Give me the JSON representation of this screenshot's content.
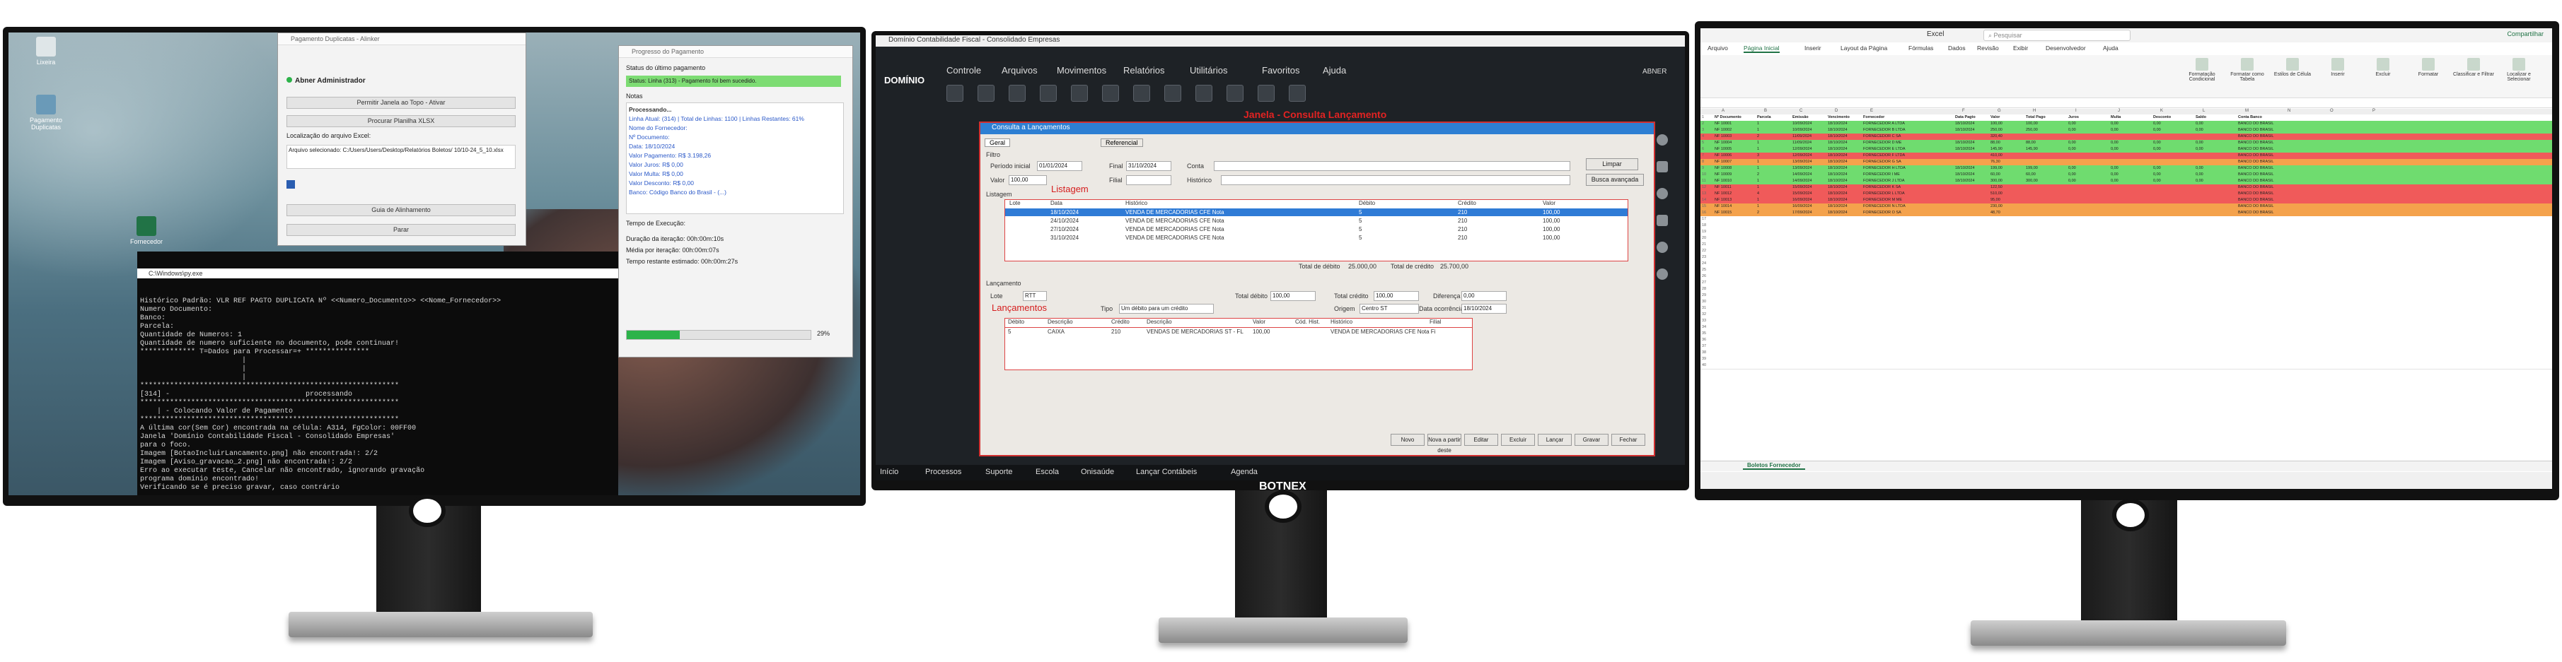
{
  "left": {
    "desktop_icons": [
      {
        "label": "Lixeira"
      },
      {
        "label": "Pagamento Duplicatas"
      },
      {
        "label": "Fornecedor"
      }
    ],
    "window_a": {
      "title": "Pagamento Duplicatas - Alinker",
      "admin_label": "Abner Administrador",
      "buttons": [
        "Permitir Janela ao Topo - Ativar",
        "Procurar Planilha XLSX"
      ],
      "location_label": "Localização do arquivo Excel:",
      "path_text": "Arquivo selecionado: C:/Users/Users/Desktop/Relatórios Boletos/ 10/10-24_5_10.xlsx",
      "start_button": "Guia de Alinhamento",
      "stop_button": "Parar"
    },
    "window_b": {
      "title": "Progresso do Pagamento",
      "status_label": "Status do último pagamento",
      "success_text": "Status: Linha (313) - Pagamento foi bem sucedido.",
      "notes_label": "Notas",
      "notes": [
        "Processando...",
        "Linha Atual: (314) | Total de Linhas: 1100 | Linhas Restantes: 61%",
        "Nome do Fornecedor:",
        "Nº Documento:",
        "Data: 18/10/2024",
        "Valor Pagamento: R$ 3.198,26",
        "Valor Juros: R$ 0,00",
        "Valor Multa: R$ 0,00",
        "Valor Desconto: R$ 0,00",
        "Banco: Código Banco do Brasil - (...)"
      ],
      "time_label": "Tempo de Execução:",
      "timings": [
        "Duração da iteração: 00h:00m:10s",
        "Média por iteração: 00h:00m:07s",
        "Tempo restante estimado: 00h:00m:27s"
      ],
      "progress_text": "29%",
      "progress": 0.29
    },
    "terminal": {
      "title": "C:\\Windows\\py.exe",
      "lines": [
        "Histórico Padrão: VLR REF PAGTO DUPLICATA Nº <<Numero_Documento>> <<Nome_Fornecedor>>",
        "Numero Documento:",
        "Banco:",
        "Parcela:",
        "Quantidade de Numeros: 1",
        "Quantidade de numero suficiente no documento, pode continuar!",
        "************* T=Dados para Processar=+ ***************",
        "",
        "                        |",
        "                        |",
        "                        |",
        "*************************************************************",
        "[314] -                                processando",
        "*************************************************************",
        "    | - Colocando Valor de Pagamento",
        "*************************************************************",
        "A última cor(Sem Cor) encontrada na célula: A314, FgColor: 00FF00",
        "Janela 'Domínio Contabilidade Fiscal - Consolidado Empresas'",
        "para o foco.",
        "Imagem [BotaoIncluirLancamento.png] não encontrada!: 2/2",
        "Imagem [Aviso_gravacao_2.png] não encontrada!: 2/2",
        "Erro ao executar teste, Cancelar não encontrado, ignorando gravação",
        "programa domínio encontrado!",
        "Verificando se é preciso gravar, caso contrário"
      ]
    }
  },
  "middle": {
    "window_title": "Domínio Contabilidade Fiscal - Consolidado Empresas",
    "logo": "DOMÍNIO",
    "menu": [
      "Controle",
      "Arquivos",
      "Movimentos",
      "Relatórios",
      "Utilitários",
      "Favoritos",
      "Ajuda"
    ],
    "user": "ABNER",
    "caption_red": "Janela - Consulta Lançamento",
    "dialog": {
      "title": "Consulta a Lançamentos",
      "tabs": [
        "Geral",
        "Referencial"
      ],
      "filter_label": "Filtro",
      "period_label": "Período inicial",
      "period_start": "01/01/2024",
      "final_label": "Final",
      "period_end": "31/10/2024",
      "conta_label": "Conta",
      "valor_label": "Valor",
      "valor_value": "100,00",
      "filial_label": "Filial",
      "historico_label": "Histórico",
      "listagem_red": "Listagem",
      "listagem_label": "Listagem",
      "clear_button": "Limpar",
      "advanced_button": "Busca avançada",
      "grid_headers": [
        "Lote",
        "Data",
        "Histórico",
        "Débito",
        "Crédito",
        "Valor"
      ],
      "grid_rows": [
        {
          "date": "18/10/2024",
          "hist": "VENDA DE MERCADORIAS CFE Nota",
          "deb": "5",
          "cred": "210",
          "val": "100,00",
          "selected": true
        },
        {
          "date": "24/10/2024",
          "hist": "VENDA DE MERCADORIAS CFE Nota",
          "deb": "5",
          "cred": "210",
          "val": "100,00",
          "selected": false
        },
        {
          "date": "27/10/2024",
          "hist": "VENDA DE MERCADORIAS CFE Nota",
          "deb": "5",
          "cred": "210",
          "val": "100,00",
          "selected": false
        },
        {
          "date": "31/10/2024",
          "hist": "VENDA DE MERCADORIAS CFE Nota",
          "deb": "5",
          "cred": "210",
          "val": "100,00",
          "selected": false
        }
      ],
      "total_debito_label": "Total de débito",
      "total_debito": "25.000,00",
      "total_credito_label": "Total de crédito",
      "total_credito": "25.700,00",
      "lancamento_label": "Lançamento",
      "lote_label": "Lote",
      "lote_value": "RTT",
      "origem_label": "Origem",
      "origem_value": "Centro ST",
      "tipo_label": "Tipo",
      "tipo_value": "Um débito para um crédito",
      "total_debito2_label": "Total débito",
      "total_debito2": "100,00",
      "total_credito2_label": "Total crédito",
      "total_credito2": "100,00",
      "diferenca_label": "Diferença",
      "diferenca": "0,00",
      "data_ocorrencia_label": "Data ocorrência",
      "data_ocorrencia": "18/10/2024",
      "lancamentos_red": "Lançamentos",
      "entry_headers": [
        "Débito",
        "Descrição",
        "Crédito",
        "Descrição",
        "Valor",
        "Cód. Hist.",
        "Histórico",
        "Filial"
      ],
      "entry_row": {
        "debito": "5",
        "desc1": "CAIXA",
        "credito": "210",
        "desc2": "VENDAS DE MERCADORIAS ST - FL",
        "valor": "100,00",
        "hist": "VENDA DE MERCADORIAS CFE Nota Fi"
      },
      "buttons": [
        "Novo",
        "Nova a partir deste",
        "Editar",
        "Excluir",
        "Lançar",
        "Gravar",
        "Fechar"
      ]
    },
    "taskbar": [
      "Início",
      "Processos",
      "Suporte",
      "Escola",
      "Onisaúde",
      "Lançar Contábeis",
      "Agenda"
    ]
  },
  "right": {
    "title": "Excel",
    "search_placeholder": "Pesquisar",
    "share_label": "Compartilhar",
    "ribbon_tabs": [
      "Arquivo",
      "Página Inicial",
      "Inserir",
      "Layout da Página",
      "Fórmulas",
      "Dados",
      "Revisão",
      "Exibir",
      "Desenvolvedor",
      "Ajuda"
    ],
    "ribbon_buttons": [
      "Formatação Condicional",
      "Formatar como Tabela",
      "Estilos de Célula",
      "Inserir",
      "Excluir",
      "Formatar",
      "Classificar e Filtrar",
      "Localizar e Selecionar"
    ],
    "sheet_tab": "Boletos Fornecedor",
    "column_headers": [
      "A",
      "B",
      "C",
      "D",
      "E",
      "F",
      "G",
      "H",
      "I",
      "J",
      "K",
      "L",
      "M",
      "N",
      "O",
      "P"
    ],
    "header_row": [
      "Nº Documento",
      "Parcela",
      "Emissão",
      "Vencimento",
      "Fornecedor",
      "Data Pagto",
      "Valor",
      "Total Pago",
      "Juros",
      "Multa",
      "Desconto",
      "Saldo",
      "Conta Banco"
    ],
    "row_color_names": {
      "green": "#6fdc6f",
      "red": "#f05a5a",
      "orange": "#f4a24c",
      "white": "#ffffff"
    },
    "rows": [
      {
        "c": "green",
        "v": [
          "NF 10001",
          "1",
          "10/09/2024",
          "18/10/2024",
          "FORNECEDOR A LTDA",
          "18/10/2024",
          "100,00",
          "100,00",
          "0,00",
          "0,00",
          "0,00",
          "0,00",
          "BANCO DO BRASIL"
        ]
      },
      {
        "c": "green",
        "v": [
          "NF 10002",
          "1",
          "10/09/2024",
          "18/10/2024",
          "FORNECEDOR B LTDA",
          "18/10/2024",
          "250,00",
          "250,00",
          "0,00",
          "0,00",
          "0,00",
          "0,00",
          "BANCO DO BRASIL"
        ]
      },
      {
        "c": "red",
        "v": [
          "NF 10003",
          "2",
          "11/09/2024",
          "18/10/2024",
          "FORNECEDOR C SA",
          "",
          "320,40",
          "",
          "",
          "",
          "",
          "",
          "BANCO DO BRASIL"
        ]
      },
      {
        "c": "green",
        "v": [
          "NF 10004",
          "1",
          "11/09/2024",
          "18/10/2024",
          "FORNECEDOR D ME",
          "18/10/2024",
          "88,00",
          "88,00",
          "0,00",
          "0,00",
          "0,00",
          "0,00",
          "BANCO DO BRASIL"
        ]
      },
      {
        "c": "green",
        "v": [
          "NF 10005",
          "1",
          "12/09/2024",
          "18/10/2024",
          "FORNECEDOR E LTDA",
          "18/10/2024",
          "145,90",
          "145,90",
          "0,00",
          "0,00",
          "0,00",
          "0,00",
          "BANCO DO BRASIL"
        ]
      },
      {
        "c": "red",
        "v": [
          "NF 10006",
          "3",
          "12/09/2024",
          "18/10/2024",
          "FORNECEDOR F LTDA",
          "",
          "410,00",
          "",
          "",
          "",
          "",
          "",
          "BANCO DO BRASIL"
        ]
      },
      {
        "c": "orange",
        "v": [
          "NF 10007",
          "1",
          "13/09/2024",
          "18/10/2024",
          "FORNECEDOR G SA",
          "",
          "76,30",
          "",
          "",
          "",
          "",
          "",
          "BANCO DO BRASIL"
        ]
      },
      {
        "c": "green",
        "v": [
          "NF 10008",
          "1",
          "13/09/2024",
          "18/10/2024",
          "FORNECEDOR H LTDA",
          "18/10/2024",
          "199,00",
          "199,00",
          "0,00",
          "0,00",
          "0,00",
          "0,00",
          "BANCO DO BRASIL"
        ]
      },
      {
        "c": "green",
        "v": [
          "NF 10009",
          "2",
          "14/09/2024",
          "18/10/2024",
          "FORNECEDOR I ME",
          "18/10/2024",
          "60,00",
          "60,00",
          "0,00",
          "0,00",
          "0,00",
          "0,00",
          "BANCO DO BRASIL"
        ]
      },
      {
        "c": "green",
        "v": [
          "NF 10010",
          "1",
          "14/09/2024",
          "18/10/2024",
          "FORNECEDOR J LTDA",
          "18/10/2024",
          "300,00",
          "300,00",
          "0,00",
          "0,00",
          "0,00",
          "0,00",
          "BANCO DO BRASIL"
        ]
      },
      {
        "c": "red",
        "v": [
          "NF 10011",
          "1",
          "15/09/2024",
          "18/10/2024",
          "FORNECEDOR K SA",
          "",
          "122,50",
          "",
          "",
          "",
          "",
          "",
          "BANCO DO BRASIL"
        ]
      },
      {
        "c": "red",
        "v": [
          "NF 10012",
          "4",
          "15/09/2024",
          "18/10/2024",
          "FORNECEDOR L LTDA",
          "",
          "510,00",
          "",
          "",
          "",
          "",
          "",
          "BANCO DO BRASIL"
        ]
      },
      {
        "c": "red",
        "v": [
          "NF 10013",
          "1",
          "16/09/2024",
          "18/10/2024",
          "FORNECEDOR M ME",
          "",
          "95,00",
          "",
          "",
          "",
          "",
          "",
          "BANCO DO BRASIL"
        ]
      },
      {
        "c": "orange",
        "v": [
          "NF 10014",
          "1",
          "16/09/2024",
          "18/10/2024",
          "FORNECEDOR N LTDA",
          "",
          "230,00",
          "",
          "",
          "",
          "",
          "",
          "BANCO DO BRASIL"
        ]
      },
      {
        "c": "orange",
        "v": [
          "NF 10015",
          "2",
          "17/09/2024",
          "18/10/2024",
          "FORNECEDOR O SA",
          "",
          "48,70",
          "",
          "",
          "",
          "",
          "",
          "BANCO DO BRASIL"
        ]
      }
    ],
    "white_row_count": 24
  },
  "brand": "BOTNEX"
}
